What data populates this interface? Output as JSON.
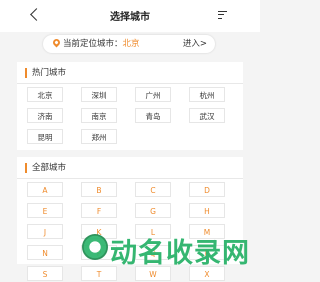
{
  "header": {
    "title": "选择城市",
    "back_icon": "back-chevron-icon",
    "menu_icon": "list-menu-icon"
  },
  "location": {
    "label": "当前定位城市：",
    "city": "北京",
    "enter": "进入>",
    "icon": "location-pin-icon",
    "accent": "#ef8b2c"
  },
  "hot": {
    "title": "热门城市",
    "cities": [
      "北京",
      "深圳",
      "广州",
      "杭州",
      "济南",
      "南京",
      "青岛",
      "武汉",
      "昆明",
      "郑州"
    ]
  },
  "all": {
    "title": "全部城市",
    "letters": [
      "A",
      "B",
      "C",
      "D",
      "E",
      "F",
      "G",
      "H",
      "J",
      "K",
      "L",
      "M",
      "N",
      "P",
      "Q",
      "R",
      "S",
      "T",
      "W",
      "X"
    ]
  },
  "watermark": {
    "text": "动名收录网"
  }
}
